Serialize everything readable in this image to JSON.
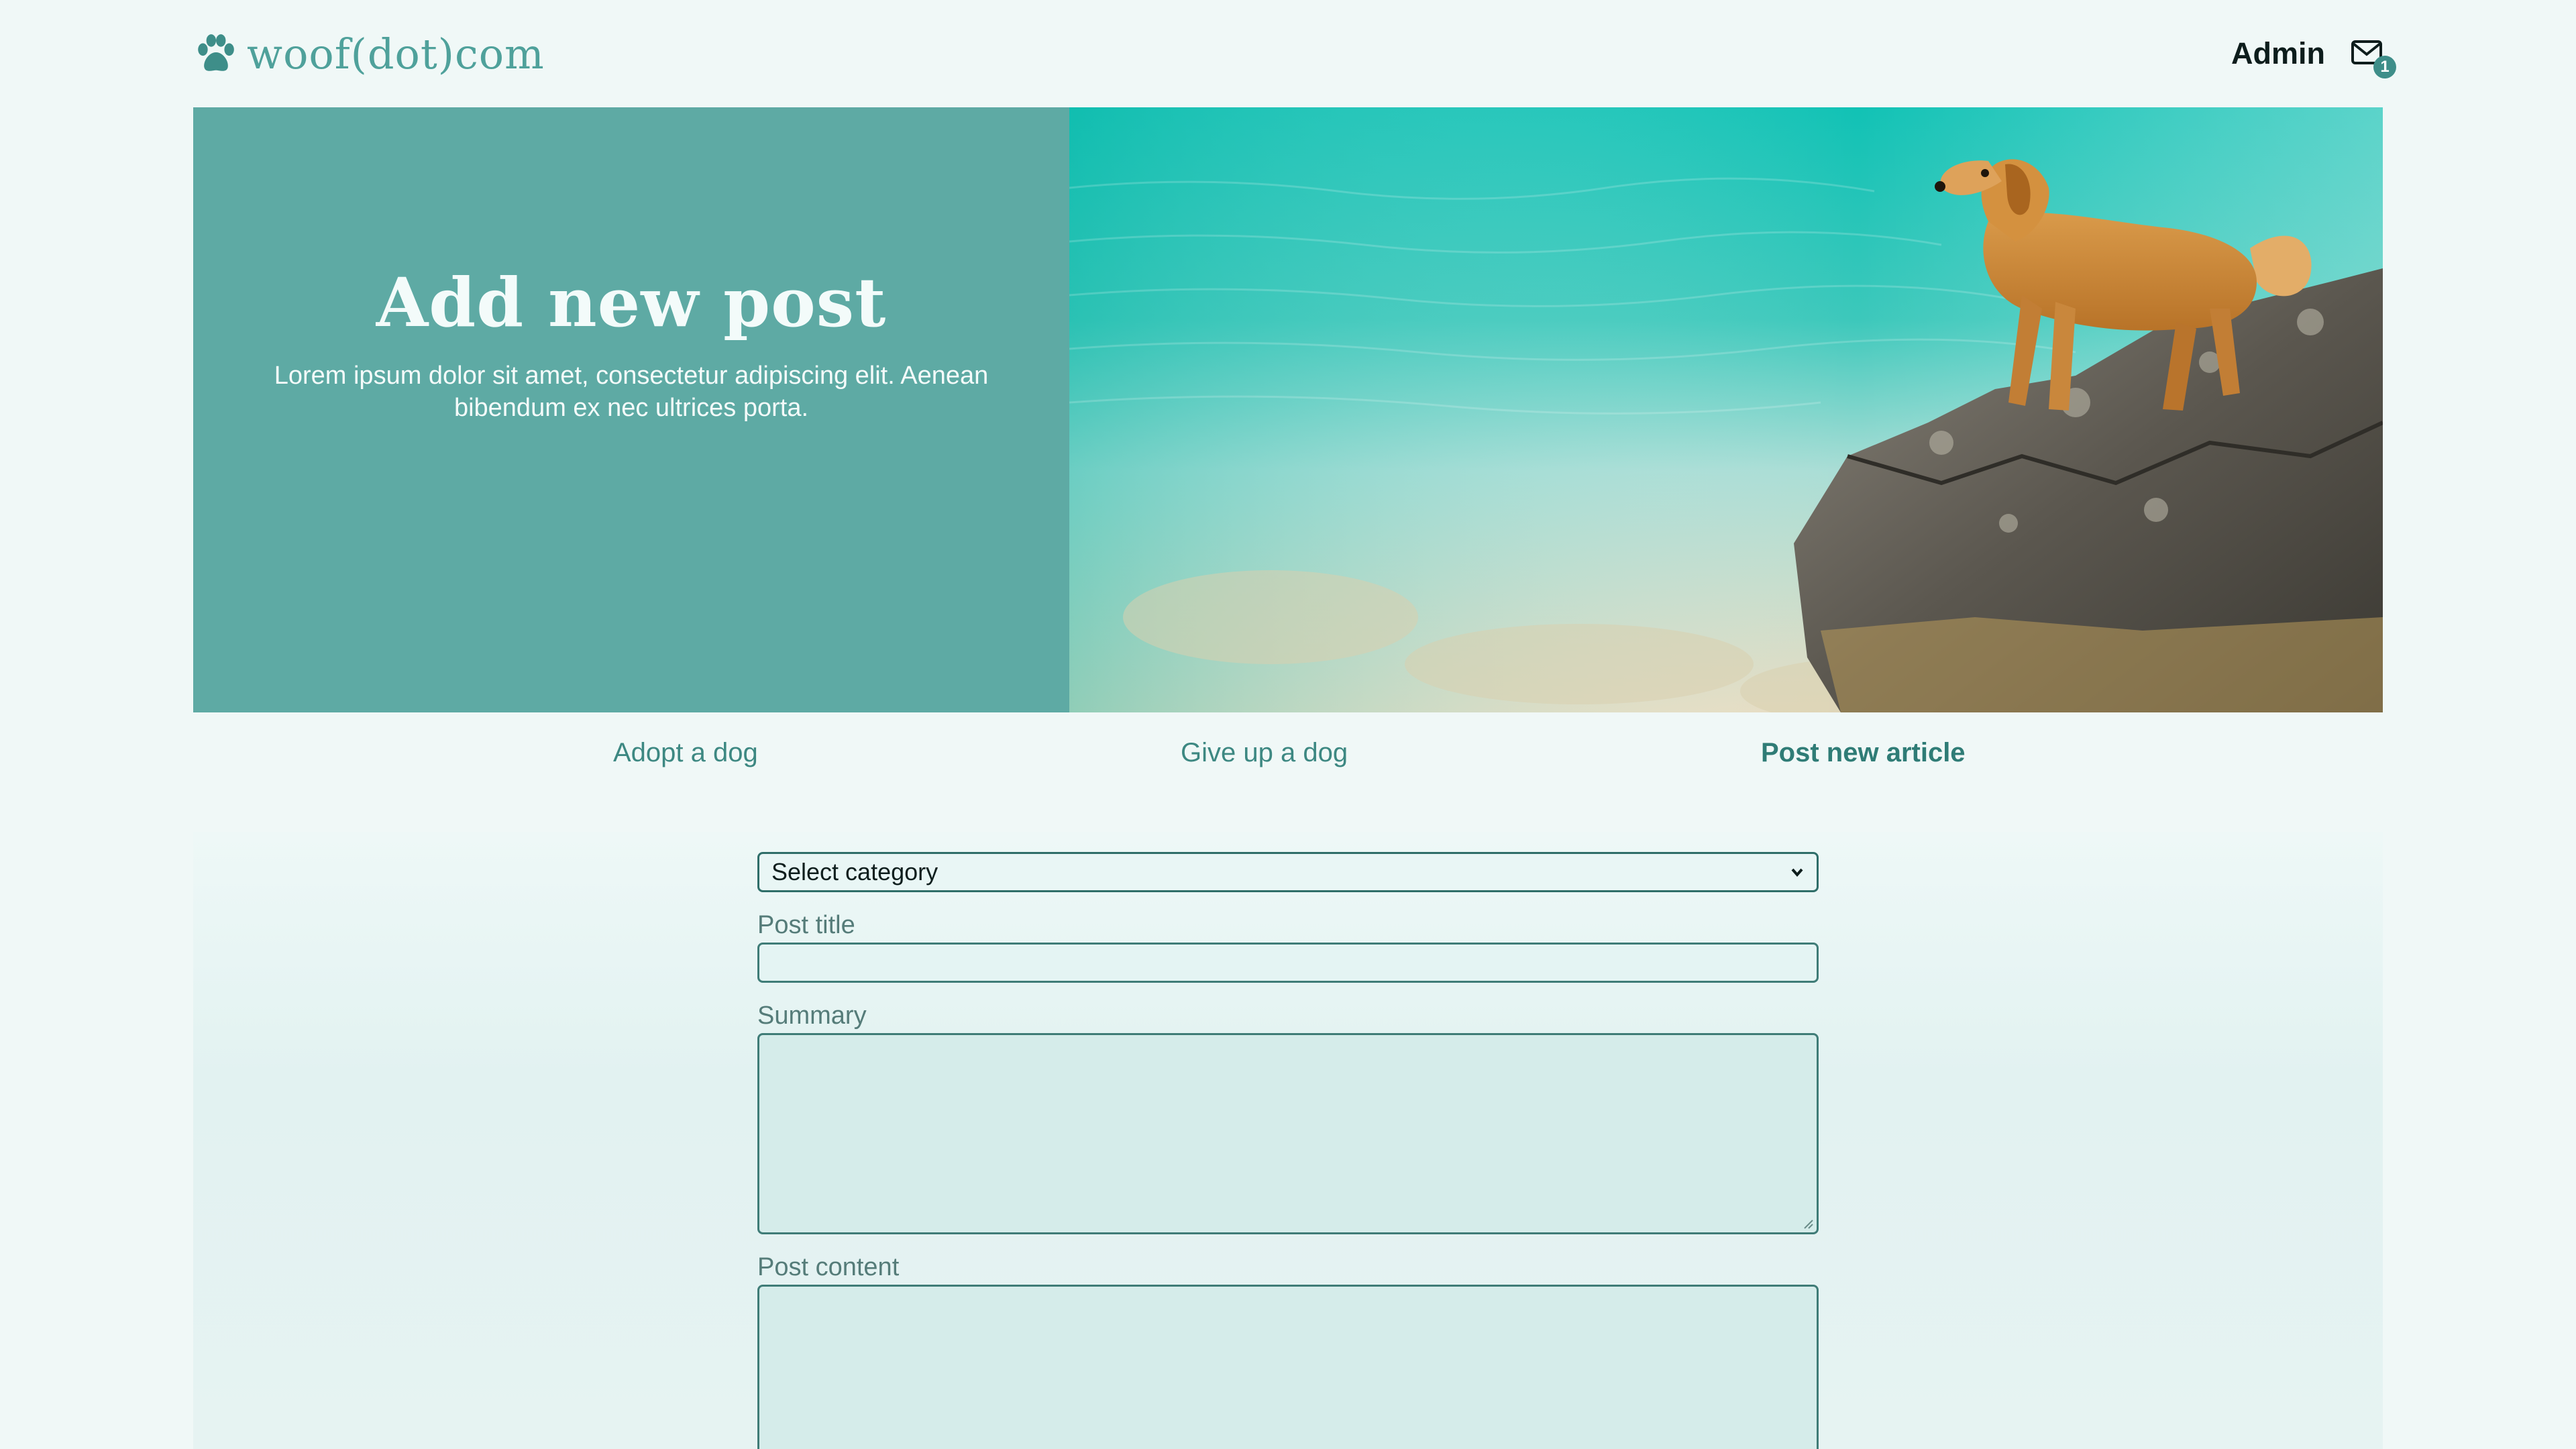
{
  "header": {
    "logo_text": "woof(dot)com",
    "logo_icon": "paw-icon",
    "user_name": "Admin",
    "mail_icon": "mail-icon",
    "mail_badge_count": "1"
  },
  "hero": {
    "title": "Add new post",
    "subtitle": "Lorem ipsum dolor sit amet, consectetur adipiscing elit. Aenean bibendum ex nec ultrices porta.",
    "image": "dog-on-rock-by-lake-photo"
  },
  "nav": {
    "items": [
      {
        "label": "Adopt a dog",
        "active": false
      },
      {
        "label": "Give up a dog",
        "active": false
      },
      {
        "label": "Post new article",
        "active": true
      }
    ]
  },
  "form": {
    "category_select": {
      "selected": "Select category"
    },
    "post_title": {
      "label": "Post title",
      "value": ""
    },
    "summary": {
      "label": "Summary",
      "value": ""
    },
    "post_content": {
      "label": "Post content",
      "value": ""
    }
  },
  "colors": {
    "accent": "#5eaaa4",
    "accent_dark": "#2f7c76",
    "background": "#f0f8f7"
  }
}
